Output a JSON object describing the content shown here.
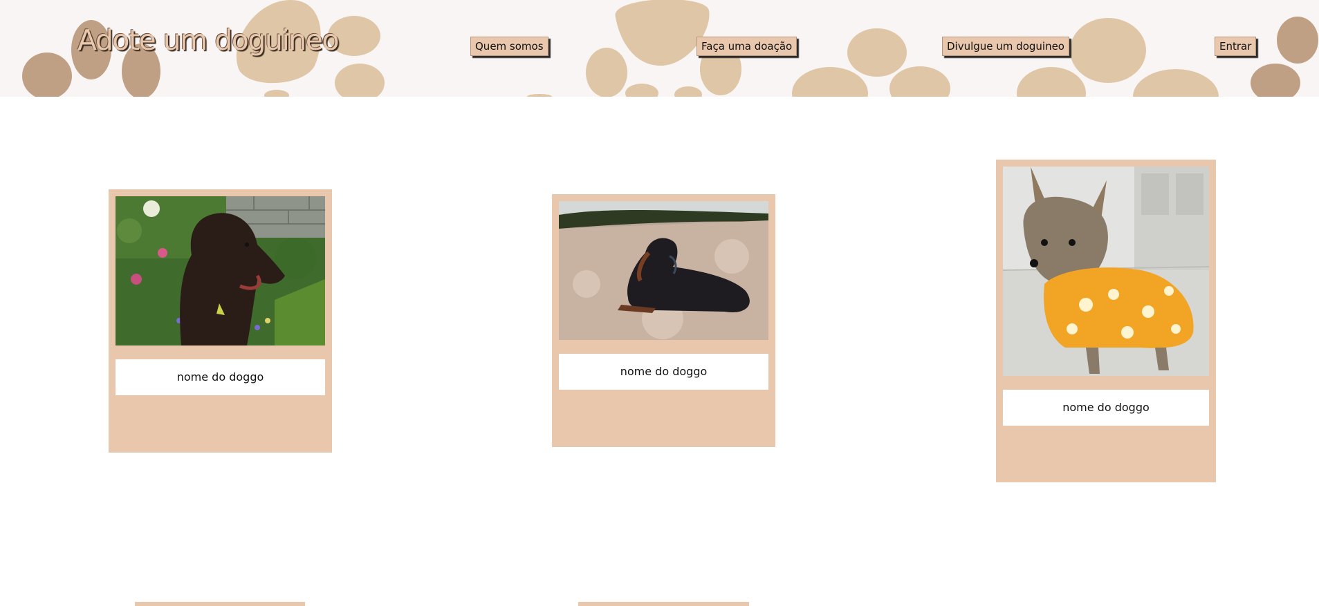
{
  "header": {
    "title": "Adote um doguineo",
    "nav": {
      "about": "Quem somos",
      "donate": "Faça uma doação",
      "share": "Divulgue um doguineo",
      "login": "Entrar"
    }
  },
  "dogs": [
    {
      "name": "nome do doggo",
      "photo": "black poodle in garden"
    },
    {
      "name": "nome do doggo",
      "photo": "dachshund lying on beach"
    },
    {
      "name": "nome do doggo",
      "photo": "yorkshire terrier in yellow shirt"
    }
  ],
  "colors": {
    "card": "#e9c7ad",
    "header_bg": "#f8f5f4",
    "paw": "#dfc6a6",
    "paw_dark": "#bfa085"
  }
}
